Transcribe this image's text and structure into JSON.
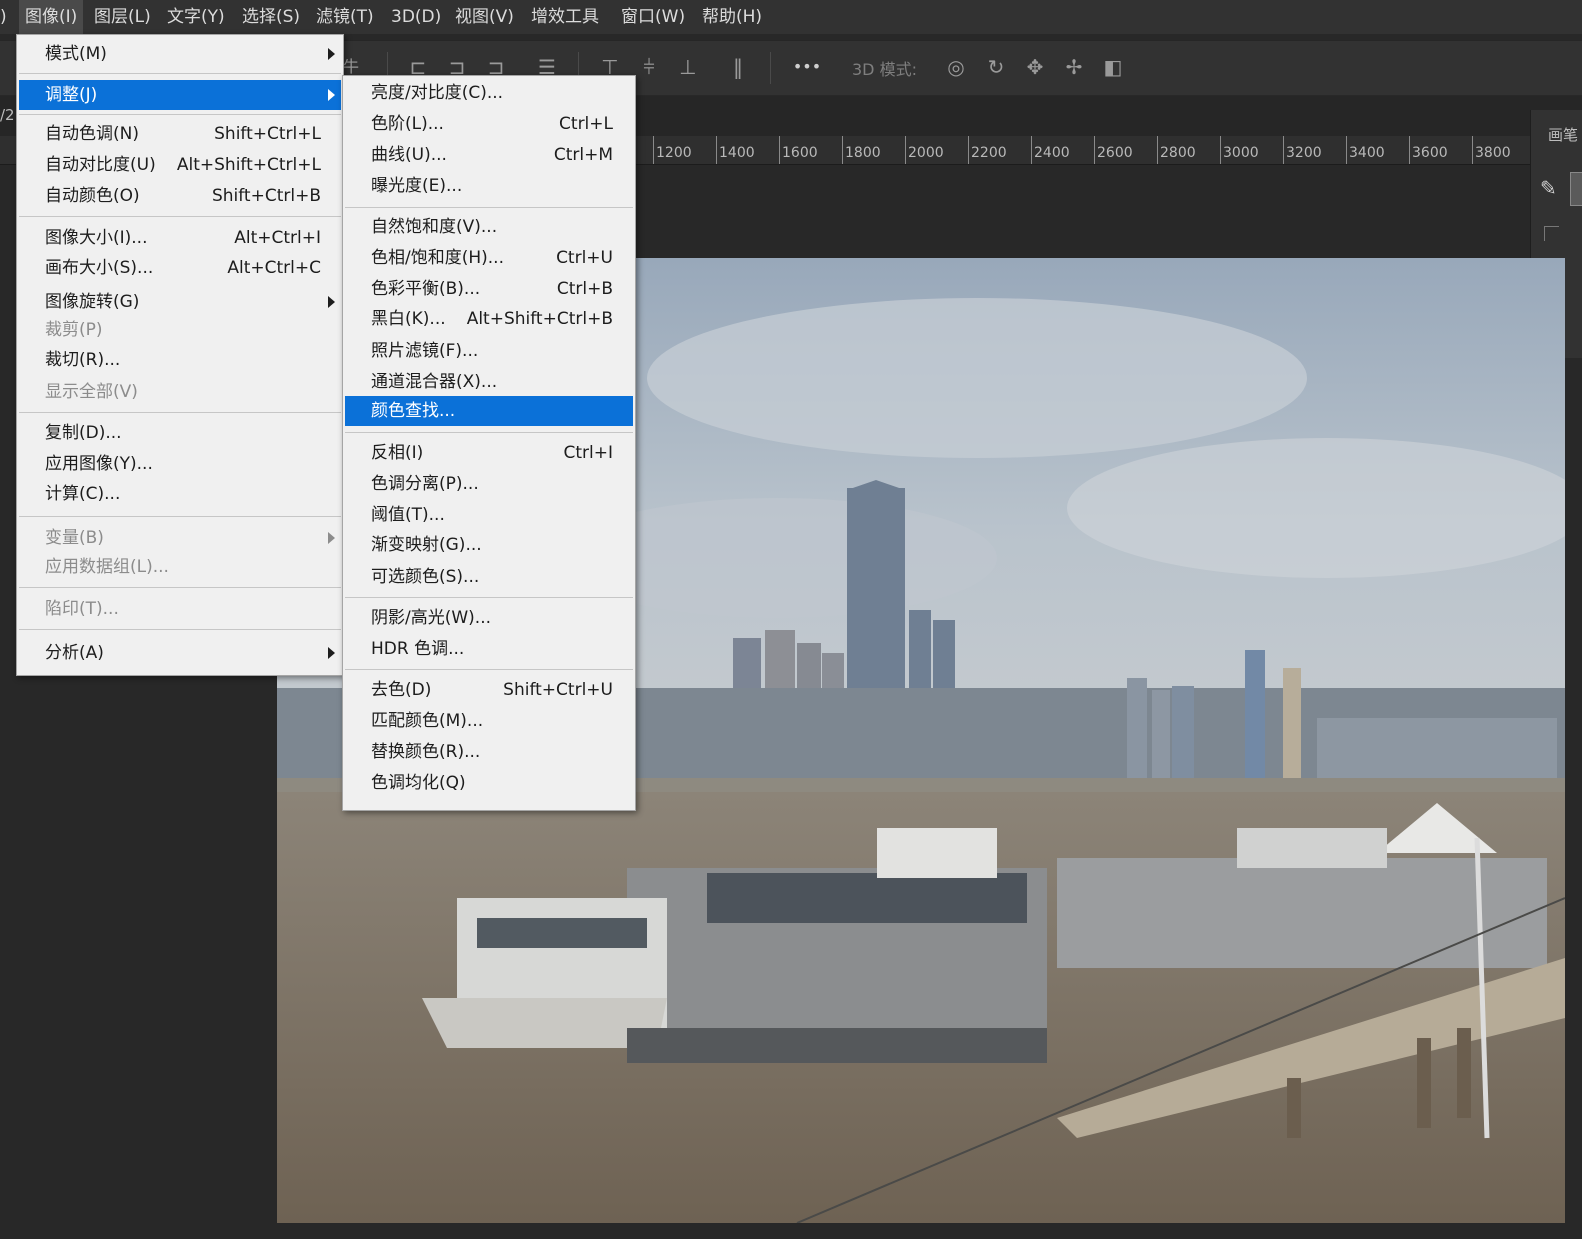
{
  "menubar": {
    "items": [
      {
        "label": ")"
      },
      {
        "label": "图像(I)"
      },
      {
        "label": "图层(L)"
      },
      {
        "label": "文字(Y)"
      },
      {
        "label": "选择(S)"
      },
      {
        "label": "滤镜(T)"
      },
      {
        "label": "3D(D)"
      },
      {
        "label": "视图(V)"
      },
      {
        "label": "增效工具"
      },
      {
        "label": "窗口(W)"
      },
      {
        "label": "帮助(H)"
      }
    ]
  },
  "optionsbar": {
    "partial_label": "牛",
    "more_label": "•••",
    "mode_3d_label": "3D 模式:"
  },
  "doc_tab": {
    "fragment": "/2."
  },
  "ruler": {
    "labels": [
      "1200",
      "1400",
      "1600",
      "1800",
      "2000",
      "2200",
      "2400",
      "2600",
      "2800",
      "3000",
      "3200",
      "3400",
      "3600",
      "3800"
    ]
  },
  "right_panel": {
    "title": "画笔"
  },
  "image_menu": {
    "items": [
      {
        "label": "模式(M)",
        "shortcut": "",
        "submenu": true,
        "disabled": false
      },
      {
        "label": "调整(J)",
        "shortcut": "",
        "submenu": true,
        "disabled": false,
        "highlighted": true
      },
      {
        "label": "自动色调(N)",
        "shortcut": "Shift+Ctrl+L",
        "disabled": false
      },
      {
        "label": "自动对比度(U)",
        "shortcut": "Alt+Shift+Ctrl+L",
        "disabled": false
      },
      {
        "label": "自动颜色(O)",
        "shortcut": "Shift+Ctrl+B",
        "disabled": false
      },
      {
        "label": "图像大小(I)...",
        "shortcut": "Alt+Ctrl+I",
        "disabled": false
      },
      {
        "label": "画布大小(S)...",
        "shortcut": "Alt+Ctrl+C",
        "disabled": false
      },
      {
        "label": "图像旋转(G)",
        "shortcut": "",
        "submenu": true,
        "disabled": false
      },
      {
        "label": "裁剪(P)",
        "shortcut": "",
        "disabled": true
      },
      {
        "label": "裁切(R)...",
        "shortcut": "",
        "disabled": false
      },
      {
        "label": "显示全部(V)",
        "shortcut": "",
        "disabled": true
      },
      {
        "label": "复制(D)...",
        "shortcut": "",
        "disabled": false
      },
      {
        "label": "应用图像(Y)...",
        "shortcut": "",
        "disabled": false
      },
      {
        "label": "计算(C)...",
        "shortcut": "",
        "disabled": false
      },
      {
        "label": "变量(B)",
        "shortcut": "",
        "submenu": true,
        "disabled": true
      },
      {
        "label": "应用数据组(L)...",
        "shortcut": "",
        "disabled": true
      },
      {
        "label": "陷印(T)...",
        "shortcut": "",
        "disabled": true
      },
      {
        "label": "分析(A)",
        "shortcut": "",
        "submenu": true,
        "disabled": false
      }
    ]
  },
  "adjust_menu": {
    "items": [
      {
        "label": "亮度/对比度(C)...",
        "shortcut": ""
      },
      {
        "label": "色阶(L)...",
        "shortcut": "Ctrl+L"
      },
      {
        "label": "曲线(U)...",
        "shortcut": "Ctrl+M"
      },
      {
        "label": "曝光度(E)...",
        "shortcut": ""
      },
      {
        "label": "自然饱和度(V)...",
        "shortcut": ""
      },
      {
        "label": "色相/饱和度(H)...",
        "shortcut": "Ctrl+U"
      },
      {
        "label": "色彩平衡(B)...",
        "shortcut": "Ctrl+B"
      },
      {
        "label": "黑白(K)...",
        "shortcut": "Alt+Shift+Ctrl+B"
      },
      {
        "label": "照片滤镜(F)...",
        "shortcut": ""
      },
      {
        "label": "通道混合器(X)...",
        "shortcut": ""
      },
      {
        "label": "颜色查找...",
        "shortcut": "",
        "highlighted": true
      },
      {
        "label": "反相(I)",
        "shortcut": "Ctrl+I"
      },
      {
        "label": "色调分离(P)...",
        "shortcut": ""
      },
      {
        "label": "阈值(T)...",
        "shortcut": ""
      },
      {
        "label": "渐变映射(G)...",
        "shortcut": ""
      },
      {
        "label": "可选颜色(S)...",
        "shortcut": ""
      },
      {
        "label": "阴影/高光(W)...",
        "shortcut": ""
      },
      {
        "label": "HDR 色调...",
        "shortcut": ""
      },
      {
        "label": "去色(D)",
        "shortcut": "Shift+Ctrl+U"
      },
      {
        "label": "匹配颜色(M)...",
        "shortcut": ""
      },
      {
        "label": "替换颜色(R)...",
        "shortcut": ""
      },
      {
        "label": "色调均化(Q)",
        "shortcut": ""
      }
    ]
  },
  "colors": {
    "highlight": "#0b71d8",
    "menu_bg": "#f0f0f0",
    "app_bg": "#282828"
  }
}
